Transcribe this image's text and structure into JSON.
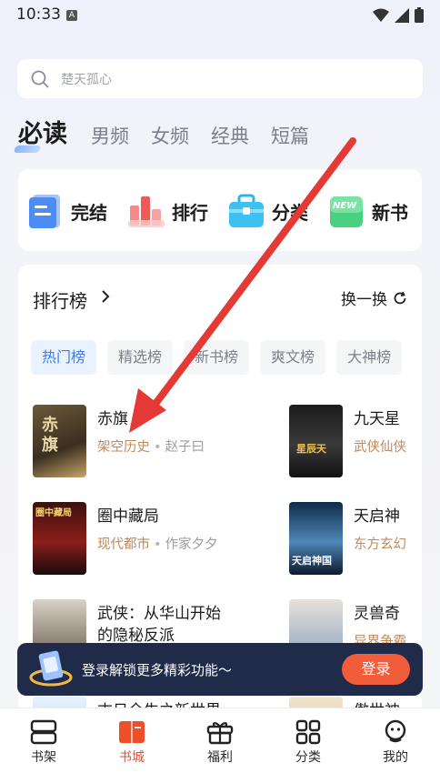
{
  "status_bar": {
    "time": "10:33",
    "notif_letter": "A"
  },
  "search": {
    "placeholder": "楚天孤心"
  },
  "tabs": [
    "必读",
    "男频",
    "女频",
    "经典",
    "短篇"
  ],
  "categories": [
    {
      "label": "完结",
      "icon": "book-complete-icon"
    },
    {
      "label": "排行",
      "icon": "ranking-bars-icon"
    },
    {
      "label": "分类",
      "icon": "toolbox-icon"
    },
    {
      "label": "新书",
      "icon": "new-book-icon",
      "badge": "NEW"
    }
  ],
  "rank": {
    "title": "排行榜",
    "refresh": "换一换",
    "chips": [
      "热门榜",
      "精选榜",
      "新书榜",
      "爽文榜",
      "大神榜"
    ],
    "books_left": [
      {
        "title": "赤旗",
        "genre": "架空历史",
        "author": "赵子曰",
        "cover_text": "赤旗"
      },
      {
        "title": "圈中藏局",
        "genre": "现代都市",
        "author": "作家夕夕",
        "cover_text": "圈中藏局"
      },
      {
        "title": "武侠：从华山开始的隐秘反派",
        "title_lines": [
          "武侠：从华山开始",
          "的隐秘反派"
        ],
        "genre": "",
        "author": "",
        "cover_text": ""
      }
    ],
    "books_right": [
      {
        "title": "九天星",
        "genre": "武侠仙侠",
        "cover_text": "星辰天"
      },
      {
        "title": "天启神",
        "genre": "东方玄幻",
        "cover_text": "天启神国"
      },
      {
        "title": "灵兽奇",
        "genre": "异界争霸",
        "cover_text": ""
      }
    ],
    "partial_row": {
      "left_title": "末日全生之新世界",
      "right_title": "傲世神"
    }
  },
  "banner": {
    "text": "登录解锁更多精彩功能～",
    "button": "登录"
  },
  "bottom_nav": [
    {
      "label": "书架",
      "icon": "bookshelf-icon"
    },
    {
      "label": "书城",
      "icon": "bookstore-icon",
      "active": true
    },
    {
      "label": "福利",
      "icon": "gift-icon"
    },
    {
      "label": "分类",
      "icon": "category-grid-icon"
    },
    {
      "label": "我的",
      "icon": "profile-icon"
    }
  ],
  "colors": {
    "accent_blue": "#3d7bea",
    "accent_orange": "#ef4e2b",
    "genre": "#c08858",
    "annotation_arrow": "#e53935"
  }
}
